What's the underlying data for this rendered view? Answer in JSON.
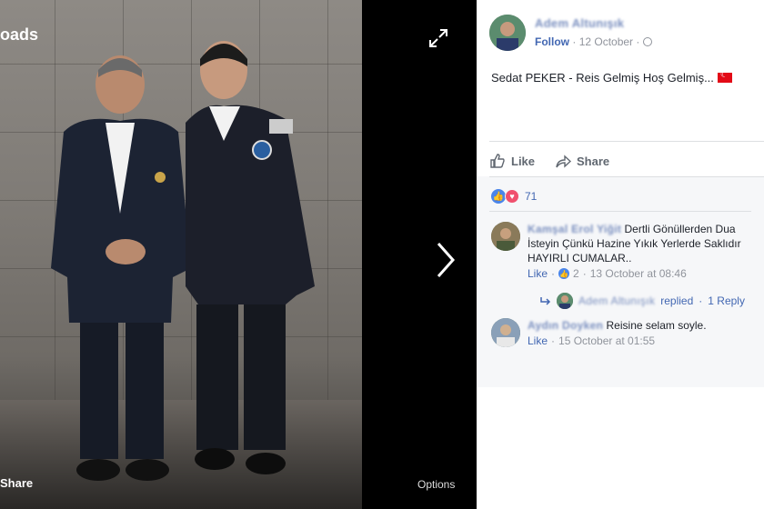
{
  "viewer": {
    "overlay_top_text": "oads",
    "share_label": "Share",
    "options_label": "Options",
    "expand_icon": "expand-icon",
    "next_icon": "chevron-right-icon"
  },
  "post": {
    "author": "Adem Altunışık",
    "follow_label": "Follow",
    "date": "12 October",
    "privacy_icon": "globe-icon",
    "text": "Sedat PEKER - Reis Gelmiş Hoş Gelmiş...",
    "flag_icon": "turkey-flag-icon",
    "like_label": "Like",
    "share_label": "Share",
    "reaction_count": "71"
  },
  "comments": [
    {
      "author": "Kamşal Erol Yiğit",
      "text": "Dertli Gönüllerden Dua İsteyin Çünkü Hazine Yıkık Yerlerde Saklıdır HAYIRLI CUMALAR..",
      "like_label": "Like",
      "like_count": "2",
      "timestamp": "13 October at 08:46",
      "reply_author": "Adem Altunışık",
      "reply_action": "replied",
      "reply_count": "1 Reply"
    },
    {
      "author": "Aydın Doyken",
      "text": "Reisine selam soyle.",
      "like_label": "Like",
      "timestamp": "15 October at 01:55"
    }
  ],
  "colors": {
    "link": "#4267b2",
    "muted": "#90949c",
    "like_blue": "#4a85ea",
    "love_red": "#f0506e"
  }
}
